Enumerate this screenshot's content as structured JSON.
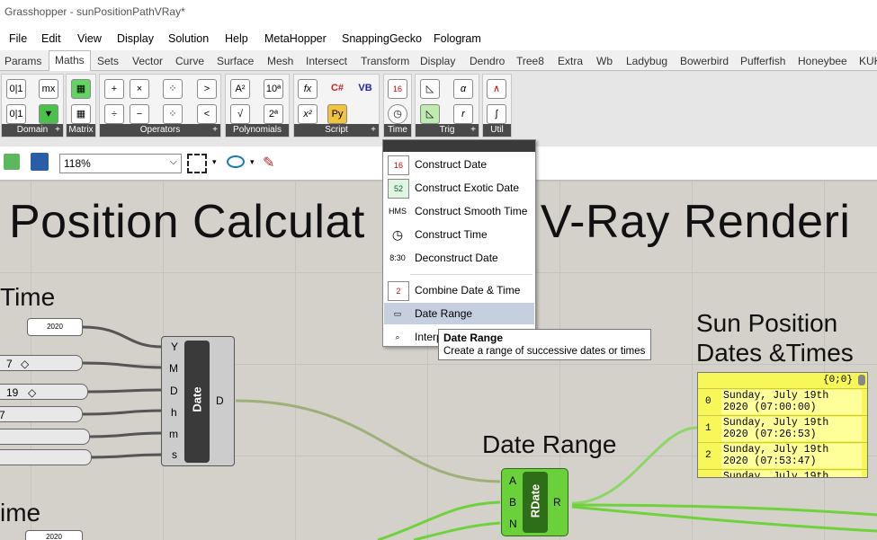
{
  "window": {
    "title": "Grasshopper - sunPositionPathVRay*"
  },
  "menu": [
    "File",
    "Edit",
    "View",
    "Display",
    "Solution",
    "Help",
    "MetaHopper",
    "SnappingGecko",
    "Fologram"
  ],
  "tabs": [
    "Params",
    "Maths",
    "Sets",
    "Vector",
    "Curve",
    "Surface",
    "Mesh",
    "Intersect",
    "Transform",
    "Display",
    "Dendro",
    "Tree8",
    "Extra",
    "Wb",
    "Ladybug",
    "Bowerbird",
    "Pufferfish",
    "Honeybee",
    "KUK"
  ],
  "active_tab": "Maths",
  "ribbon_groups": [
    "Domain",
    "Matrix",
    "Operators",
    "Polynomials",
    "Script",
    "Time",
    "Trig",
    "Util"
  ],
  "toolbar": {
    "zoom": "118%"
  },
  "canvas": {
    "title": "Position Calculat",
    "title_tail": "l V-Ray Renderi",
    "time_header": "Time",
    "time_header2": "ime",
    "panel_2020": "2020",
    "panel_2020b": "2020",
    "sliders": [
      "7",
      "19",
      "7"
    ],
    "date_component": {
      "label": "Date",
      "inputs": [
        "Y",
        "M",
        "D",
        "h",
        "m",
        "s"
      ],
      "output": "D"
    },
    "date_range_heading": "Date Range",
    "rdate": {
      "label": "RDate",
      "inputs": [
        "A",
        "B",
        "N"
      ],
      "output": "R"
    },
    "sun_heading_1": "Sun Position",
    "sun_heading_2": "Dates &Times",
    "panel": {
      "path": "{0;0}",
      "rows": [
        {
          "index": "0",
          "line1": "Sunday, July 19th",
          "line2": "2020 (07:00:00)"
        },
        {
          "index": "1",
          "line1": "Sunday, July 19th",
          "line2": "2020 (07:26:53)"
        },
        {
          "index": "2",
          "line1": "Sunday, July 19th",
          "line2": "2020 (07:53:47)"
        },
        {
          "index": "",
          "line1": "Sunday, July 19th",
          "line2": ""
        }
      ]
    }
  },
  "dropdown": {
    "items": [
      "Construct Date",
      "Construct Exotic Date",
      "Construct Smooth Time",
      "Construct Time",
      "Deconstruct Date",
      "Combine Date & Time",
      "Date Range",
      "Interp"
    ],
    "icons": [
      "16",
      "52",
      "HMS",
      "◷",
      "8:30",
      "2",
      "▭",
      "⌕"
    ],
    "highlighted": "Date Range"
  },
  "tooltip": {
    "title": "Date Range",
    "description": "Create a range of successive dates or times"
  }
}
